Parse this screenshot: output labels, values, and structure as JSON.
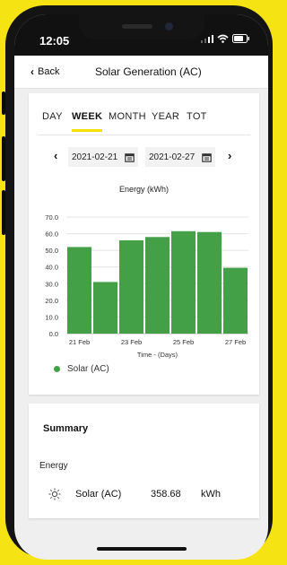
{
  "status_bar": {
    "time": "12:05"
  },
  "nav": {
    "back_label": "Back",
    "title": "Solar Generation (AC)"
  },
  "tabs": [
    {
      "label": "DAY",
      "active": false
    },
    {
      "label": "WEEK",
      "active": true
    },
    {
      "label": "MONTH",
      "active": false
    },
    {
      "label": "YEAR",
      "active": false
    },
    {
      "label": "TOT",
      "active": false
    }
  ],
  "date_range": {
    "start": "2021-02-21",
    "end": "2021-02-27"
  },
  "chart_data": {
    "type": "bar",
    "title": "Energy (kWh)",
    "xlabel": "Time - (Days)",
    "ylabel": "",
    "categories": [
      "21 Feb",
      "22 Feb",
      "23 Feb",
      "24 Feb",
      "25 Feb",
      "26 Feb",
      "27 Feb"
    ],
    "x_tick_labels": [
      "21 Feb",
      "23 Feb",
      "25 Feb",
      "27 Feb"
    ],
    "y_tick_labels": [
      "0.0",
      "10.0",
      "20.0",
      "30.0",
      "40.0",
      "50.0",
      "60.0",
      "70.0"
    ],
    "series": [
      {
        "name": "Solar (AC)",
        "values": [
          52.0,
          31.0,
          56.0,
          58.0,
          61.5,
          61.0,
          39.5
        ],
        "color": "#43a047"
      }
    ],
    "ylim": [
      0,
      70
    ],
    "grid": true,
    "legend_position": "bottom-left"
  },
  "summary": {
    "title": "Summary",
    "energy_label": "Energy",
    "row": {
      "icon": "sun-icon",
      "name": "Solar (AC)",
      "value": "358.68",
      "unit": "kWh"
    }
  },
  "colors": {
    "accent": "#f5e314",
    "bar": "#43a047"
  }
}
